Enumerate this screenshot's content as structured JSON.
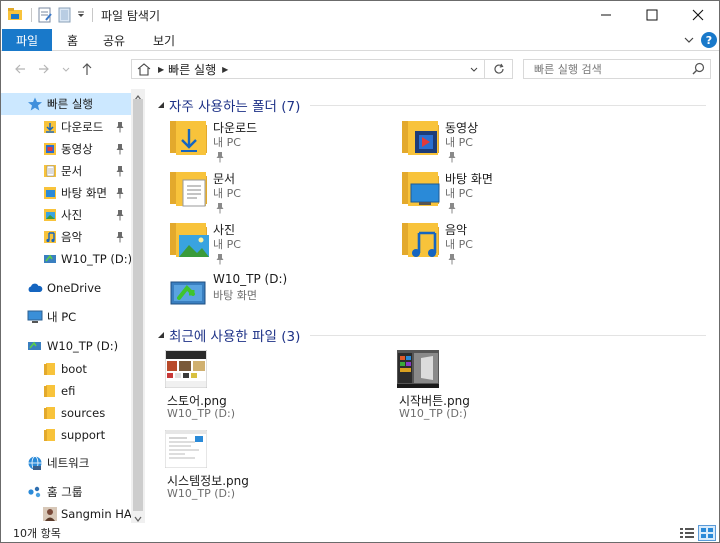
{
  "window": {
    "title": "파일 탐색기"
  },
  "ribbon": {
    "tabs": [
      "파일",
      "홈",
      "공유",
      "보기"
    ]
  },
  "address": {
    "path": [
      "빠른 실행"
    ],
    "search_placeholder": "빠른 실행 검색"
  },
  "nav": {
    "items": [
      {
        "label": "빠른 실행",
        "icon": "star-icon"
      },
      {
        "label": "다운로드",
        "icon": "download-folder-icon",
        "pinned": true
      },
      {
        "label": "동영상",
        "icon": "video-folder-icon",
        "pinned": true
      },
      {
        "label": "문서",
        "icon": "documents-folder-icon",
        "pinned": true
      },
      {
        "label": "바탕 화면",
        "icon": "desktop-folder-icon",
        "pinned": true
      },
      {
        "label": "사진",
        "icon": "pictures-folder-icon",
        "pinned": true
      },
      {
        "label": "음악",
        "icon": "music-folder-icon",
        "pinned": true
      },
      {
        "label": "W10_TP (D:)",
        "icon": "drive-icon"
      },
      {
        "label": "OneDrive",
        "icon": "onedrive-icon"
      },
      {
        "label": "내 PC",
        "icon": "pc-icon"
      },
      {
        "label": "W10_TP (D:)",
        "icon": "drive-icon"
      },
      {
        "label": "boot",
        "icon": "folder-icon"
      },
      {
        "label": "efi",
        "icon": "folder-icon"
      },
      {
        "label": "sources",
        "icon": "folder-icon"
      },
      {
        "label": "support",
        "icon": "folder-icon"
      },
      {
        "label": "네트워크",
        "icon": "network-icon"
      },
      {
        "label": "홈 그룹",
        "icon": "homegroup-icon"
      },
      {
        "label": "Sangmin HAN",
        "icon": "user-avatar-icon"
      }
    ]
  },
  "frequent": {
    "title": "자주 사용하는 폴더 (7)",
    "folders": [
      {
        "name": "다운로드",
        "location": "내 PC"
      },
      {
        "name": "동영상",
        "location": "내 PC"
      },
      {
        "name": "문서",
        "location": "내 PC"
      },
      {
        "name": "바탕 화면",
        "location": "내 PC"
      },
      {
        "name": "사진",
        "location": "내 PC"
      },
      {
        "name": "음악",
        "location": "내 PC"
      },
      {
        "name": "W10_TP (D:)",
        "location": "바탕 화면"
      }
    ]
  },
  "recent": {
    "title": "최근에 사용한 파일 (3)",
    "files": [
      {
        "name": "스토어.png",
        "location": "W10_TP (D:)"
      },
      {
        "name": "시작버튼.png",
        "location": "W10_TP (D:)"
      },
      {
        "name": "시스템정보.png",
        "location": "W10_TP (D:)"
      }
    ]
  },
  "status": {
    "count": "10개 항목"
  },
  "colors": {
    "accent": "#1979ca",
    "group_title": "#1e3287",
    "folder": "#f8c33b",
    "selection": "#cce8ff"
  }
}
